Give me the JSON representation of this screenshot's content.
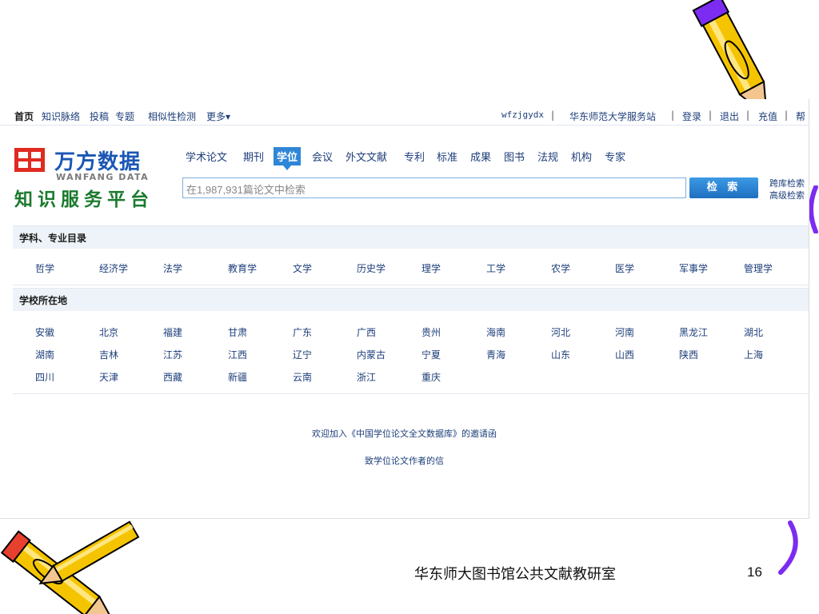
{
  "topbar": {
    "home": "首页",
    "links": [
      "知识脉络",
      "投稿",
      "专题",
      "相似性检测",
      "更多▾"
    ],
    "user": "wfzjgydx",
    "site": "华东师范大学服务站",
    "login": "登录",
    "logout": "退出",
    "recharge": "充值",
    "help": "帮"
  },
  "logo": {
    "cn": "万方数据",
    "en": "WANFANG DATA",
    "sub": "知识服务平台"
  },
  "tabs": [
    "学术论文",
    "期刊",
    "学位",
    "会议",
    "外文文献",
    "专利",
    "标准",
    "成果",
    "图书",
    "法规",
    "机构",
    "专家"
  ],
  "active_tab": "学位",
  "search": {
    "placeholder": "在1,987,931篇论文中检索",
    "button": "检 索",
    "cross_search": "跨库检索",
    "advanced_search": "高级检索"
  },
  "subjects": {
    "heading": "学科、专业目录",
    "items": [
      "哲学",
      "经济学",
      "法学",
      "教育学",
      "文学",
      "历史学",
      "理学",
      "工学",
      "农学",
      "医学",
      "军事学",
      "管理学"
    ]
  },
  "locations": {
    "heading": "学校所在地",
    "rows": [
      [
        "安徽",
        "北京",
        "福建",
        "甘肃",
        "广东",
        "广西",
        "贵州",
        "海南",
        "河北",
        "河南",
        "黑龙江",
        "湖北"
      ],
      [
        "湖南",
        "吉林",
        "江苏",
        "江西",
        "辽宁",
        "内蒙古",
        "宁夏",
        "青海",
        "山东",
        "山西",
        "陕西",
        "上海"
      ],
      [
        "四川",
        "天津",
        "西藏",
        "新疆",
        "云南",
        "浙江",
        "重庆"
      ]
    ]
  },
  "notices": {
    "invite": "欢迎加入《中国学位论文全文数据库》的邀请函",
    "letter": "致学位论文作者的信"
  },
  "footer": {
    "text": "华东师大图书馆公共文献教研室",
    "page": "16"
  },
  "colors": {
    "link": "#1d3e7a",
    "accent": "#2f86d6",
    "logo_blue": "#1a56b5",
    "logo_green": "#1b7a2e",
    "logo_red": "#e02a20",
    "deco_purple": "#7b2cf0"
  }
}
